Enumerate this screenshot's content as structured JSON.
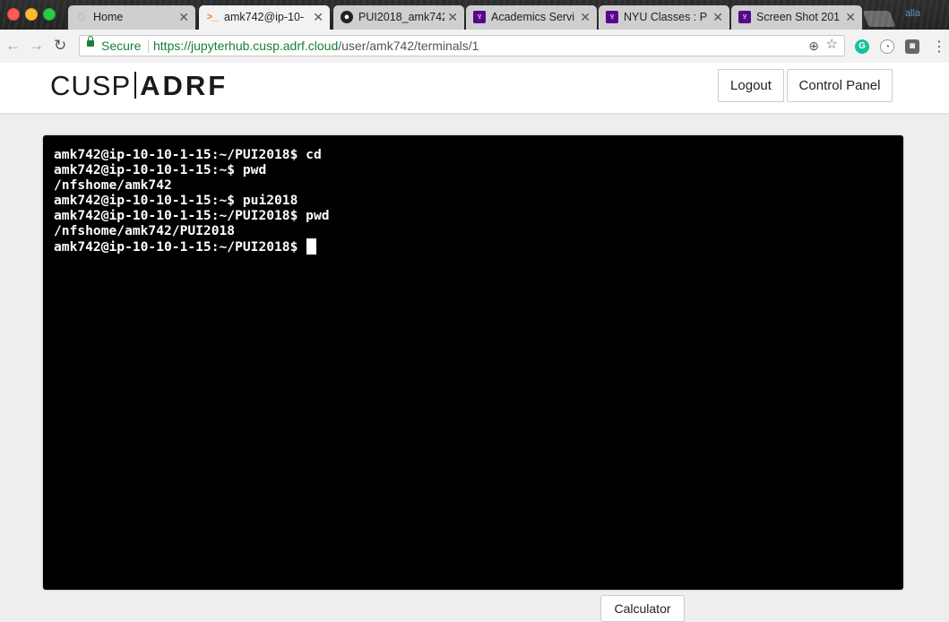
{
  "browser": {
    "tabs": [
      {
        "label": "Home",
        "icon": "jupyter-icon",
        "icon_color": "#f37726"
      },
      {
        "label": "amk742@ip-10-",
        "icon": "terminal-icon",
        "icon_color": "#f37726",
        "active": true
      },
      {
        "label": "PUI2018_amk742",
        "icon": "github-icon",
        "icon_color": "#222222"
      },
      {
        "label": "Academics Servi",
        "icon": "nyu-torch-icon",
        "icon_color": "#57068c"
      },
      {
        "label": "NYU Classes : P",
        "icon": "nyu-torch-icon",
        "icon_color": "#57068c"
      },
      {
        "label": "Screen Shot 201",
        "icon": "nyu-torch-icon",
        "icon_color": "#57068c"
      }
    ],
    "corner_text": "alla",
    "secure_label": "Secure",
    "url_host": "https://jupyterhub.cusp.adrf.cloud",
    "url_path": "/user/amk742/terminals/1"
  },
  "header": {
    "logo_left": "CUSP",
    "logo_right": "ADRF",
    "logout_label": "Logout",
    "control_panel_label": "Control Panel"
  },
  "terminal": {
    "lines": [
      "amk742@ip-10-10-1-15:~/PUI2018$ cd",
      "amk742@ip-10-10-1-15:~$ pwd",
      "/nfshome/amk742",
      "amk742@ip-10-10-1-15:~$ pui2018",
      "amk742@ip-10-10-1-15:~/PUI2018$ pwd",
      "/nfshome/amk742/PUI2018",
      "amk742@ip-10-10-1-15:~/PUI2018$ "
    ]
  },
  "footer": {
    "calculator_label": "Calculator"
  },
  "colors": {
    "secure_green": "#188038",
    "terminal_bg": "#000000",
    "terminal_fg": "#ffffff"
  }
}
